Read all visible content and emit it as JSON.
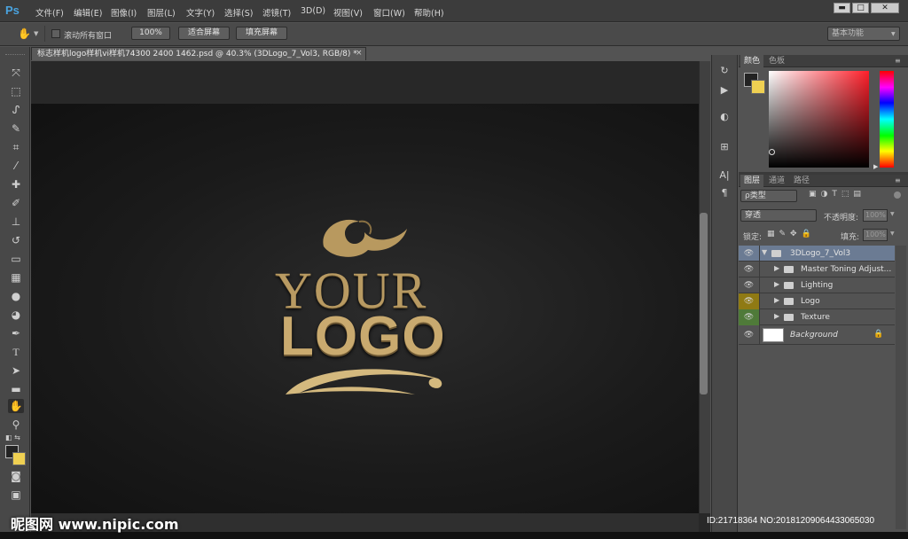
{
  "app": {
    "logo": "Ps"
  },
  "menu": [
    "文件(F)",
    "编辑(E)",
    "图像(I)",
    "图层(L)",
    "文字(Y)",
    "选择(S)",
    "滤镜(T)",
    "3D(D)",
    "视图(V)",
    "窗口(W)",
    "帮助(H)"
  ],
  "window_buttons": {
    "minimize": "▬",
    "restore": "□",
    "close": "✕"
  },
  "options": {
    "scroll_all_label": "滚动所有窗口",
    "zoom_100": "100%",
    "fit_screen": "适合屏幕",
    "fill_screen": "填充屏幕",
    "workspace": "基本功能"
  },
  "document": {
    "tab_title": "标志样机logo样机vi样机74300 2400 1462.psd @ 40.3% (3DLogo_7_Vol3, RGB/8) *",
    "close": "×",
    "logo_top": "YOUR",
    "logo_bottom": "LOGO"
  },
  "colors": {
    "foreground": "#232323",
    "background": "#efd052",
    "gold": "#c9aa6f"
  },
  "color_panel": {
    "tabs": [
      "颜色",
      "色板"
    ]
  },
  "layers_panel": {
    "tabs": [
      "图层",
      "通道",
      "路径"
    ],
    "filter_label": "ρ类型",
    "blend_mode": "穿透",
    "opacity_label": "不透明度:",
    "opacity_value": "100%",
    "lock_label": "锁定:",
    "fill_label": "填充:",
    "fill_value": "100%",
    "layers": [
      {
        "name": "3DLogo_7_Vol3"
      },
      {
        "name": "Master Toning Adjust..."
      },
      {
        "name": "Lighting"
      },
      {
        "name": "Logo"
      },
      {
        "name": "Texture"
      },
      {
        "name": "Background"
      }
    ]
  },
  "watermark": {
    "left": "昵图网 www.nipic.com",
    "right": "ID:21718364 NO:20181209064433065030"
  }
}
